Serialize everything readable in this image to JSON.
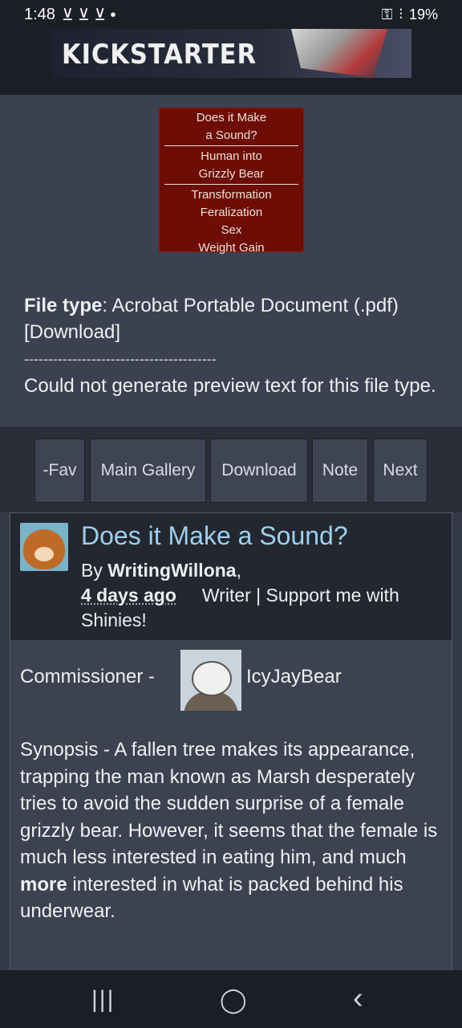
{
  "status_bar": {
    "time": "1:48",
    "left_icons": "⊻ ⊻ ⊻ •",
    "battery": "19%"
  },
  "banner": {
    "text": "KICKSTARTER"
  },
  "thumbnail": {
    "lines_top": [
      "Does it Make",
      "a Sound?"
    ],
    "lines_mid": [
      "Human into",
      "Grizzly Bear"
    ],
    "lines_bottom": [
      "Transformation",
      "Feralization",
      "Sex",
      "Weight Gain"
    ]
  },
  "file": {
    "type_label": "File type",
    "type_value": ": Acrobat Portable Document (.pdf)",
    "download_link": "[Download]",
    "separator": "----------------------------------------",
    "preview_note": "Could not generate preview text for this file type."
  },
  "buttons": {
    "fav": "-Fav",
    "gallery": "Main Gallery",
    "download": "Download",
    "note": "Note",
    "next": "Next"
  },
  "submission": {
    "title": "Does it Make a Sound?",
    "by": "By ",
    "author": "WritingWillona",
    "date": "4 days ago",
    "author_tagline": "Writer | Support me with Shinies!",
    "commissioner_label": "Commissioner -",
    "commissioner_name": "IcyJayBear",
    "synopsis_start": "Synopsis - A fallen tree makes its appearance, trapping the man known as Marsh desperately tries to avoid the sudden surprise of a female grizzly bear. However, it seems that the female is much less interested in eating him, and much ",
    "synopsis_bold": "more",
    "synopsis_end": " interested in what is packed behind his underwear."
  },
  "nav": {
    "recent": "|||",
    "home": "◯",
    "back": "‹"
  }
}
